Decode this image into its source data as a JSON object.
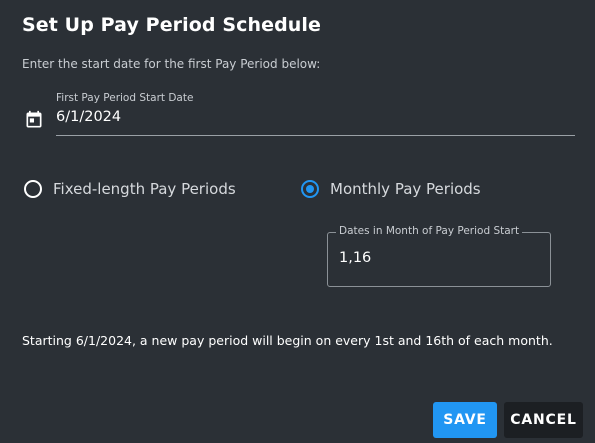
{
  "dialog": {
    "title": "Set Up Pay Period Schedule",
    "instruction": "Enter the start date for the first Pay Period below:",
    "start_date": {
      "label": "First Pay Period Start Date",
      "value": "6/1/2024",
      "icon": "calendar-icon"
    },
    "options": [
      {
        "label": "Fixed-length Pay Periods",
        "selected": false
      },
      {
        "label": "Monthly Pay Periods",
        "selected": true
      }
    ],
    "dates_in_month": {
      "label": "Dates in Month of Pay Period Start",
      "value": "1,16"
    },
    "summary": "Starting 6/1/2024, a new pay period will begin on every 1st and 16th of each month.",
    "buttons": {
      "save": "SAVE",
      "cancel": "CANCEL"
    },
    "colors": {
      "background": "#2b3036",
      "accent": "#2196f3",
      "cancel_button": "#1c1f23"
    }
  }
}
